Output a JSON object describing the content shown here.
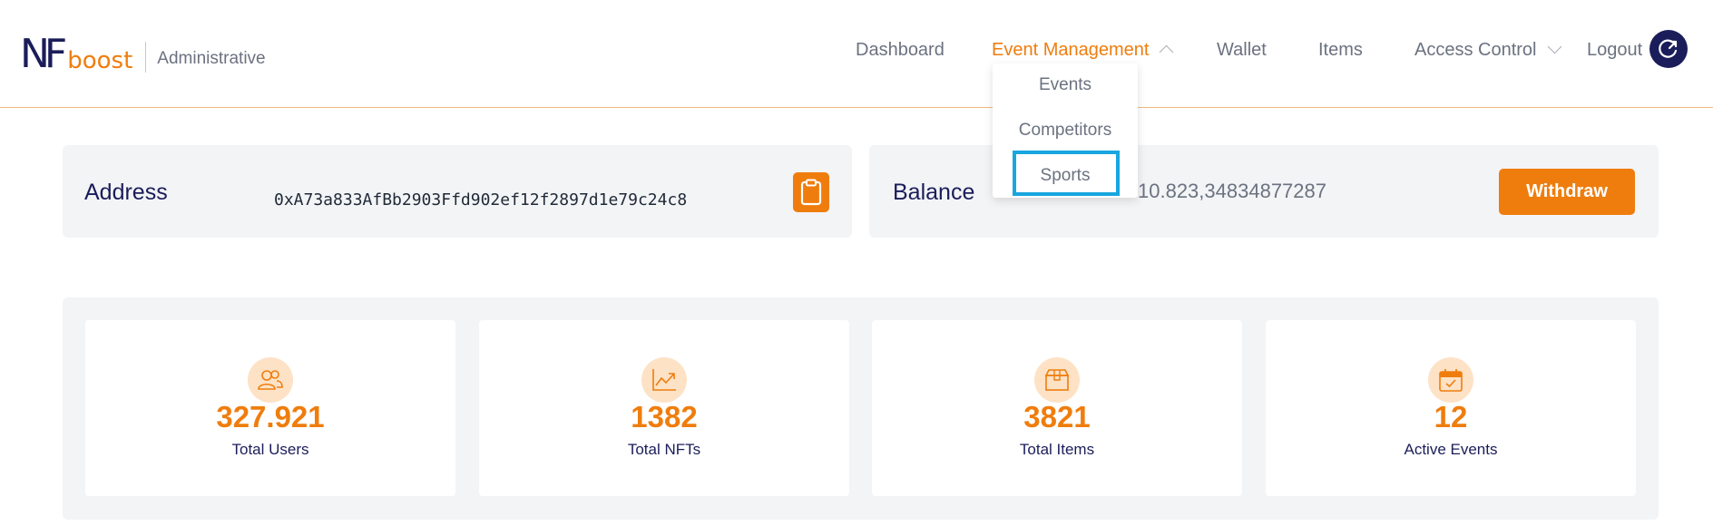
{
  "brand": {
    "logo_nf": "NF",
    "logo_boost": "boost",
    "subtitle": "Administrative"
  },
  "nav": {
    "dashboard": "Dashboard",
    "event_management": "Event Management",
    "wallet": "Wallet",
    "items": "Items",
    "access_control": "Access Control",
    "logout": "Logout"
  },
  "dropdown": {
    "items": [
      "Events",
      "Competitors",
      "Sports"
    ]
  },
  "address": {
    "label": "Address",
    "value": "0xA73a833AfBb2903Ffd902ef12f2897d1e79c24c8"
  },
  "balance": {
    "label": "Balance",
    "value": "10.823,34834877287",
    "withdraw_label": "Withdraw"
  },
  "stats": [
    {
      "value": "327.921",
      "label": "Total Users",
      "icon": "users-icon"
    },
    {
      "value": "1382",
      "label": "Total NFTs",
      "icon": "chart-icon"
    },
    {
      "value": "3821",
      "label": "Total Items",
      "icon": "box-icon"
    },
    {
      "value": "12",
      "label": "Active Events",
      "icon": "calendar-icon"
    }
  ],
  "colors": {
    "accent": "#ef7d0d",
    "navy": "#1b1d5a",
    "highlight": "#18a6df",
    "card_bg": "#f3f4f6"
  }
}
